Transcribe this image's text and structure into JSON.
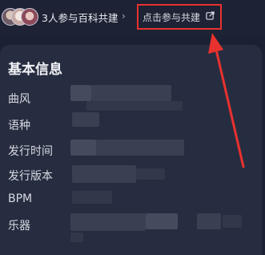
{
  "header": {
    "participants_text": "3人参与百科共建",
    "join_link_label": "点击参与共建",
    "chevron": "›",
    "avatars": [
      "avatar-1",
      "avatar-2",
      "avatar-3"
    ],
    "external_icon": "external-link-icon"
  },
  "annotation": {
    "box_color": "#e8322f",
    "arrow_color": "#e8322f"
  },
  "info": {
    "title": "基本信息",
    "fields": [
      {
        "label": "曲风"
      },
      {
        "label": "语种"
      },
      {
        "label": "发行时间"
      },
      {
        "label": "发行版本"
      },
      {
        "label": "BPM"
      },
      {
        "label": "乐器"
      }
    ]
  }
}
